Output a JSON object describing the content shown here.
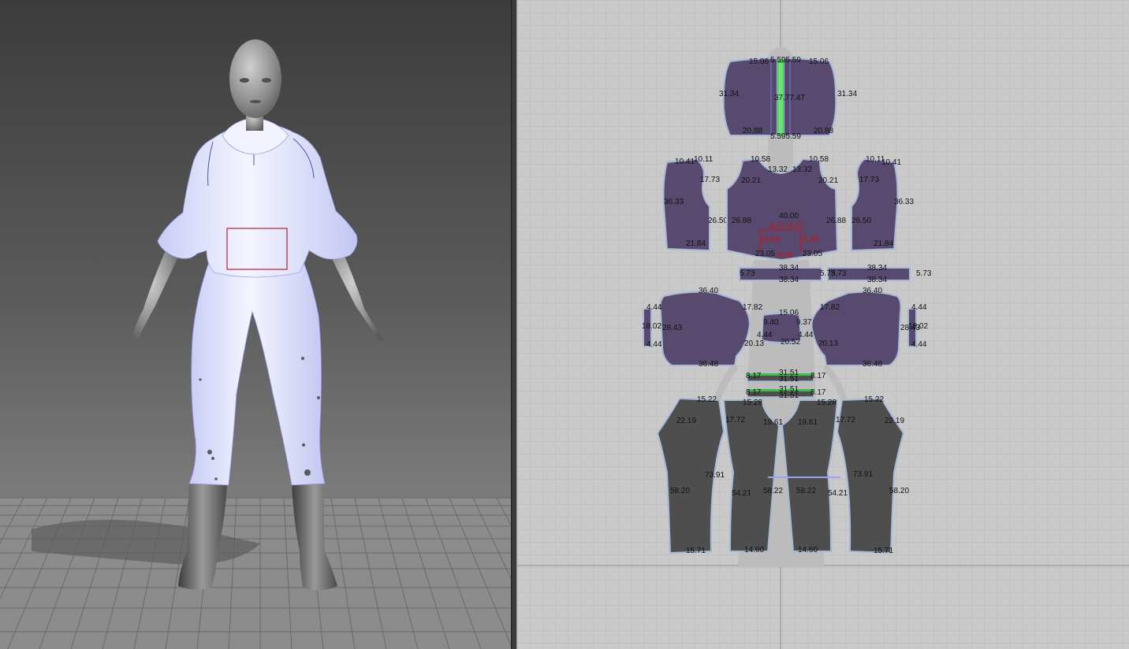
{
  "panels": {
    "viewport_3d": "3D avatar viewport",
    "viewport_2d": "2D pattern window"
  },
  "colors": {
    "pattern_purple": "#574a6e",
    "pattern_dark": "#4e4e4e",
    "garment_white": "#eef0ff",
    "seam_outline": "#a7b9d8",
    "measure_red": "#d01010",
    "green_strip": "#3cc24c"
  },
  "measurements": {
    "hood": {
      "top_left": "15.06",
      "top_mid": "5.595.59",
      "top_right": "15.06",
      "left": "31.34",
      "right": "31.34",
      "center": "37.77.47",
      "bottom_left": "20.88",
      "bottom_mid": "5.595.59",
      "bottom_right": "20.88"
    },
    "sleeve_left": {
      "top_a": "10.41",
      "top_b": "10.11",
      "inner": "17.73",
      "side": "36.33",
      "mid": "26.50",
      "bottom": "21.84"
    },
    "front_bodice": {
      "top_left": "10.58",
      "top_right": "10.58",
      "neck_left": "13.32",
      "neck_right": "13.32",
      "arm_left": "20.21",
      "arm_right": "20.21",
      "side_left": "26.88",
      "side_right": "26.88",
      "center": "40.00",
      "pocket_a": "9.17",
      "pocket_b": "9.17",
      "pocket_c": "13.43",
      "pocket_d": "13.43",
      "bottom_left": "23.05",
      "bottom_mid": "9.26",
      "bottom_mid2": "9.36",
      "bottom_right": "23.05"
    },
    "sleeve_right": {
      "top_a": "10.11",
      "top_b": "10.41",
      "inner": "17.73",
      "side": "36.33",
      "mid": "26.50",
      "bottom": "21.84"
    },
    "cuffs": {
      "left_top": "38.34",
      "left_bottom": "38.34",
      "left_end": "5.73",
      "left_end2": "5.73",
      "right_top": "38.34",
      "right_bottom": "38.34",
      "right_end": "5.73",
      "right_end2": "5.73"
    },
    "back_panel": {
      "left_top": "36.40",
      "right_top": "36.40",
      "inner_left": "17.82",
      "inner_right": "17.82",
      "small_a": "4.44",
      "small_b": "4.44",
      "small_c": "4.44",
      "small_d": "4.44",
      "strip_left": "18.02",
      "strip_left2": "28.43",
      "strip_right": "28.43",
      "strip_right2": "18.02",
      "left_bottom": "36.48",
      "right_bottom": "36.48",
      "center_top": "15.06",
      "center_left": "9.40",
      "center_right": "9.37",
      "center_bottom": "20.52",
      "center_small_l": "4.44",
      "center_small_r": "4.44",
      "lower_left": "20.13",
      "lower_right": "20.13"
    },
    "waistband": {
      "row1_left": "8.17",
      "row1_mid": "31.51",
      "row1_mid2": "31.51",
      "row1_right": "8.17",
      "row2_left": "8.17",
      "row2_mid": "31.51",
      "row2_mid2": "31.51",
      "row2_right": "8.17"
    },
    "pants": {
      "outer_top_l": "15.22",
      "outer_top_r": "15.22",
      "inner_top_l": "15.28",
      "inner_top_r": "15.28",
      "hip_l": "22.19",
      "hip_r": "22.19",
      "crotch_l": "17.72",
      "crotch_r": "17.72",
      "rise_l": "19.61",
      "rise_r": "19.61",
      "outseam_l": "73.91",
      "outseam_r": "73.91",
      "side_l": "58.20",
      "side_r": "58.20",
      "inseam_l": "54.21",
      "inseam_r": "54.21",
      "center_l": "58.22",
      "center_r": "58.22",
      "hem_outer_l": "15.71",
      "hem_outer_r": "15.71",
      "hem_inner_l": "14.60",
      "hem_inner_r": "14.60"
    }
  }
}
